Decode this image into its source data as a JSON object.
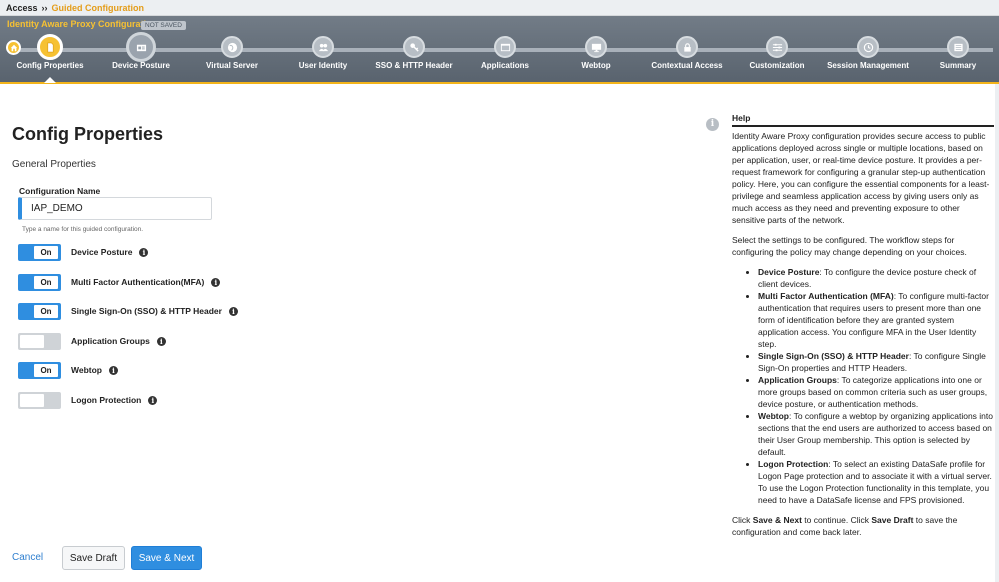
{
  "breadcrumb": {
    "root": "Access",
    "separator": "››",
    "current": "Guided Configuration"
  },
  "wizard": {
    "title": "Identity Aware Proxy Configuration",
    "status_badge": "NOT SAVED",
    "steps": [
      {
        "label": "Config Properties",
        "icon": "document-icon",
        "state": "active"
      },
      {
        "label": "Device Posture",
        "icon": "id-card-icon",
        "state": "current-ring"
      },
      {
        "label": "Virtual Server",
        "icon": "globe-icon",
        "state": "pending"
      },
      {
        "label": "User Identity",
        "icon": "users-icon",
        "state": "pending"
      },
      {
        "label": "SSO & HTTP Header",
        "icon": "key-icon",
        "state": "pending"
      },
      {
        "label": "Applications",
        "icon": "window-icon",
        "state": "pending"
      },
      {
        "label": "Webtop",
        "icon": "monitor-icon",
        "state": "pending"
      },
      {
        "label": "Contextual Access",
        "icon": "lock-icon",
        "state": "pending"
      },
      {
        "label": "Customization",
        "icon": "sliders-icon",
        "state": "pending"
      },
      {
        "label": "Session Management",
        "icon": "history-icon",
        "state": "pending"
      },
      {
        "label": "Summary",
        "icon": "list-icon",
        "state": "pending"
      }
    ]
  },
  "main": {
    "title": "Config Properties",
    "section": "General Properties",
    "config_name": {
      "label": "Configuration Name",
      "value": "IAP_DEMO",
      "hint": "Type a name for this guided configuration."
    },
    "toggles": [
      {
        "label": "Device Posture",
        "state": "on",
        "text": "On"
      },
      {
        "label": "Multi Factor Authentication(MFA)",
        "state": "on",
        "text": "On"
      },
      {
        "label": "Single Sign-On (SSO) & HTTP Header",
        "state": "on",
        "text": "On"
      },
      {
        "label": "Application Groups",
        "state": "off",
        "text": ""
      },
      {
        "label": "Webtop",
        "state": "on",
        "text": "On"
      },
      {
        "label": "Logon Protection",
        "state": "off",
        "text": ""
      }
    ]
  },
  "footer": {
    "cancel": "Cancel",
    "save_draft": "Save Draft",
    "save_next": "Save & Next"
  },
  "help": {
    "title": "Help",
    "intro": "Identity Aware Proxy configuration provides secure access to public applications deployed across single or multiple locations, based on per application, user, or real-time device posture. It provides a per-request framework for configuring a granular step-up authentication policy. Here, you can configure the essential components for a least-privilege and seamless application access by giving users only as much access as they need and preventing exposure to other sensitive parts of the network.",
    "select": "Select the settings to be configured. The workflow steps for configuring the policy may change depending on your choices.",
    "items": [
      {
        "term": "Device Posture",
        "desc": ": To configure the device posture check of client devices."
      },
      {
        "term": "Multi Factor Authentication (MFA)",
        "desc": ": To configure multi-factor authentication that requires users to present more than one form of identification before they are granted system application access. You configure MFA in the User Identity step."
      },
      {
        "term": "Single Sign-On (SSO) & HTTP Header",
        "desc": ": To configure Single Sign-On properties and HTTP Headers."
      },
      {
        "term": "Application Groups",
        "desc": ": To categorize applications into one or more groups based on common criteria such as user groups, device posture, or authentication methods."
      },
      {
        "term": "Webtop",
        "desc": ": To configure a webtop by organizing applications into sections that the end users are authorized to access based on their User Group membership. This option is selected by default."
      },
      {
        "term": "Logon Protection",
        "desc": ": To select an existing DataSafe profile for Logon Page protection and to associate it with a virtual server. To use the Logon Protection functionality in this template, you need to have a DataSafe license and FPS provisioned."
      }
    ],
    "outro": {
      "p1": "Click ",
      "b1": "Save & Next",
      "p2": " to continue. Click ",
      "b2": "Save Draft",
      "p3": " to save the configuration and come back later."
    }
  },
  "colors": {
    "accent": "#2f8ee0",
    "wizard_highlight": "#f6c133",
    "breadcrumb_current": "#e49d1a"
  }
}
